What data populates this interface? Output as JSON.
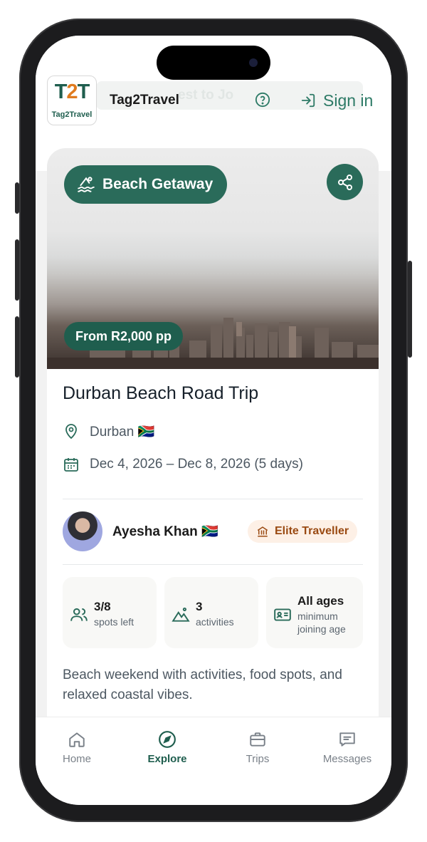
{
  "header": {
    "logo_text": "T2T",
    "logo_subtitle": "Tag2Travel",
    "brand": "Tag2Travel",
    "ghost_text": "est to Jo",
    "sign_in": "Sign in"
  },
  "trip": {
    "category": "Beach Getaway",
    "price": "From R2,000 pp",
    "title": "Durban Beach Road Trip",
    "location": "Durban 🇿🇦",
    "dates": "Dec 4, 2026 – Dec 8, 2026 (5 days)",
    "description": "Beach weekend with activities, food spots, and relaxed coastal vibes."
  },
  "host": {
    "name": "Ayesha Khan 🇿🇦",
    "badge": "Elite Traveller"
  },
  "stats": [
    {
      "value": "3/8",
      "label": "spots left",
      "icon": "people-icon"
    },
    {
      "value": "3",
      "label": "activities",
      "icon": "mountain-icon"
    },
    {
      "value": "All ages",
      "label": "minimum joining age",
      "icon": "id-card-icon"
    }
  ],
  "tabs": [
    {
      "label": "Home",
      "icon": "home-icon"
    },
    {
      "label": "Explore",
      "icon": "compass-icon"
    },
    {
      "label": "Trips",
      "icon": "briefcase-icon"
    },
    {
      "label": "Messages",
      "icon": "message-icon"
    }
  ],
  "colors": {
    "primary": "#2a6b5a",
    "accent": "#e07b1f",
    "badge_bg": "#fdf0e6"
  }
}
